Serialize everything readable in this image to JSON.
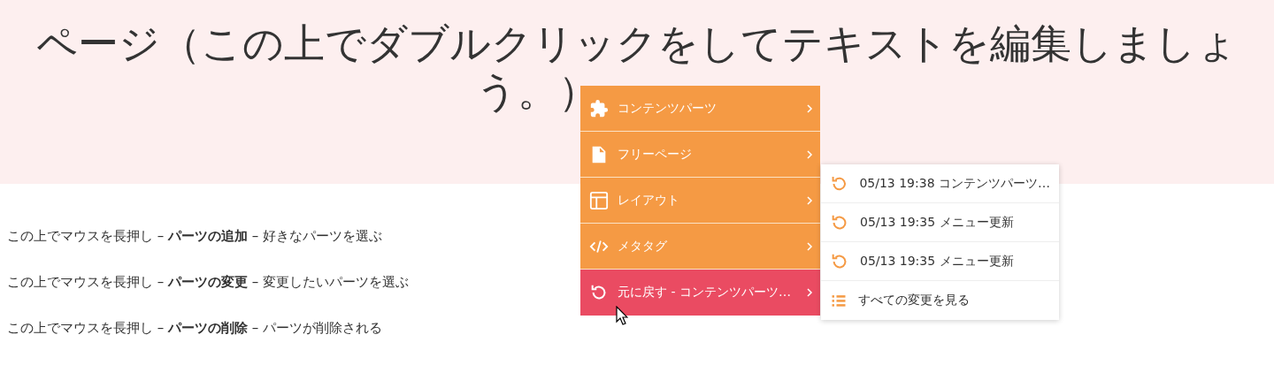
{
  "header": {
    "title_lines": [
      "ページ（この上でダブルクリックをしてテキストを編集しましょ",
      "う。）"
    ]
  },
  "paragraphs": [
    "この上でマウスを長押し – **パーツの追加** – 好きなパーツを選ぶ",
    "この上でマウスを長押し – **パーツの変更** – 変更したいパーツを選ぶ",
    "この上でマウスを長押し – **パーツの削除** – パーツが削除される"
  ],
  "menu": {
    "items": [
      {
        "label": "コンテンツパーツ",
        "selected": false
      },
      {
        "label": "フリーページ",
        "selected": false
      },
      {
        "label": "レイアウト",
        "selected": false
      },
      {
        "label": "メタタグ",
        "selected": false
      },
      {
        "label": "元に戻す - コンテンツパーツ…",
        "selected": true
      }
    ]
  },
  "submenu": {
    "items": [
      {
        "kind": "revert",
        "label": "05/13 19:38 コンテンツパーツ…"
      },
      {
        "kind": "revert",
        "label": "05/13 19:35 メニュー更新"
      },
      {
        "kind": "revert",
        "label": "05/13 19:35 メニュー更新"
      },
      {
        "kind": "all",
        "label": "すべての変更を見る"
      }
    ]
  }
}
